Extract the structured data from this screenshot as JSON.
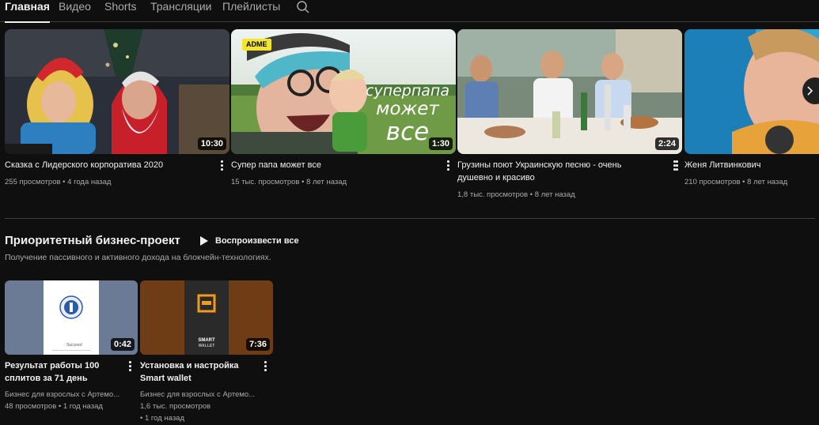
{
  "tabs": [
    {
      "label": "Главная",
      "active": true
    },
    {
      "label": "Видео",
      "active": false
    },
    {
      "label": "Shorts",
      "active": false
    },
    {
      "label": "Трансляции",
      "active": false
    },
    {
      "label": "Плейлисты",
      "active": false
    }
  ],
  "videos": [
    {
      "title": "Сказка с Лидерского корпоратива 2020",
      "duration": "10:30",
      "views": "255 просмотров",
      "age": "4 года назад"
    },
    {
      "title": "Супер папа может все",
      "duration": "1:30",
      "views": "15 тыс. просмотров",
      "age": "8 лет назад",
      "badge": "ADME",
      "overlay_lines": [
        "суперпапа",
        "может",
        "все"
      ]
    },
    {
      "title_lines": [
        "Грузины поют Украинскую песню - очень",
        "душевно и красиво"
      ],
      "duration": "2:24",
      "views": "1,8 тыс. просмотров",
      "age": "8 лет назад"
    },
    {
      "title": "Женя Литвинкович",
      "duration": "",
      "views": "210 просмотров",
      "age": "8 лет назад"
    }
  ],
  "shelf": {
    "title": "Приоритетный бизнес-проект",
    "play_all": "Воспроизвести все",
    "description": "Получение пассивного и активного дохода на блокчейн-технологиях.",
    "videos": [
      {
        "title_lines": [
          "Результат работы 100",
          "сплитов за 71 день"
        ],
        "duration": "0:42",
        "channel": "Бизнес для взрослых с Артемо...",
        "views": "48 просмотров",
        "age": "1 год назад",
        "thumb_text": "Success!"
      },
      {
        "title_lines": [
          "Установка и настройка",
          "Smart wallet"
        ],
        "duration": "7:36",
        "channel": "Бизнес для взрослых с Артемо...",
        "views": "1,6 тыс. просмотров",
        "age": "1 год назад",
        "thumb_text_lines": [
          "SMART",
          "WALLET"
        ]
      }
    ]
  },
  "meta_separator": "•",
  "colors": {
    "background": "#0f0f0f",
    "text": "#f1f1f1",
    "secondary_text": "#aaaaaa",
    "divider": "#3f3f3f",
    "badge": "#f5e52d"
  }
}
